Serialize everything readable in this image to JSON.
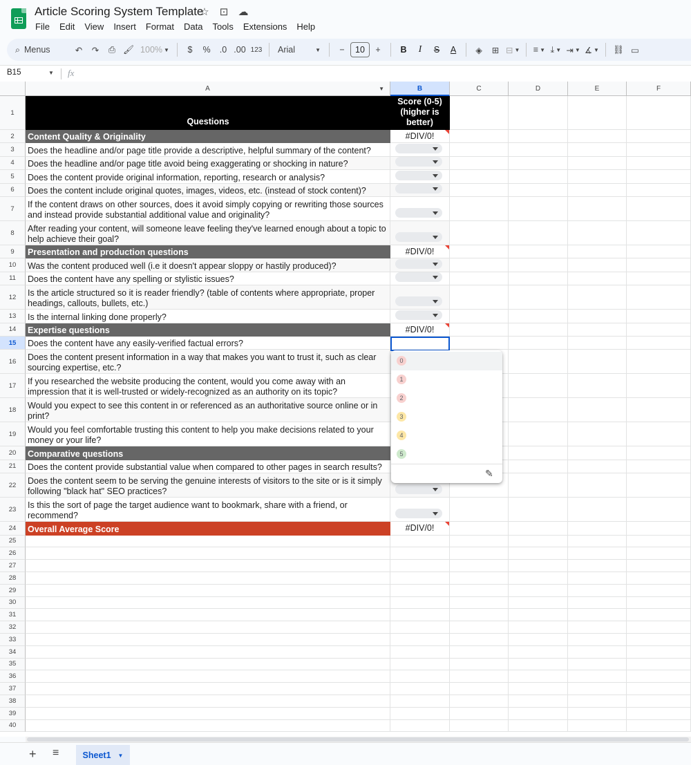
{
  "app": {
    "title": "Article Scoring System Template",
    "title_icons": [
      "star-icon",
      "move-to-folder-icon",
      "cloud-saved-icon"
    ],
    "menu": [
      "File",
      "Edit",
      "View",
      "Insert",
      "Format",
      "Data",
      "Tools",
      "Extensions",
      "Help"
    ]
  },
  "toolbar": {
    "menus_label": "Menus",
    "zoom": "100%",
    "currency": "$",
    "percent": "%",
    "dec_decrease": ".0",
    "dec_increase": ".00",
    "number_format": "123",
    "font": "Arial",
    "font_size": "10",
    "minus": "−",
    "plus": "+",
    "bold": "B",
    "italic": "I",
    "strike": "S",
    "text_color": "A"
  },
  "formula_bar": {
    "name_box": "B15",
    "fx": "fx"
  },
  "columns": [
    "A",
    "B",
    "C",
    "D",
    "E",
    "F"
  ],
  "selected_column": "B",
  "selected_row": 15,
  "rows": [
    {
      "num": 1,
      "type": "header",
      "a": "Questions",
      "b": "Score (0-5) (higher is better)"
    },
    {
      "num": 2,
      "type": "section",
      "a": "Content Quality & Originality",
      "b": "#DIV/0!"
    },
    {
      "num": 3,
      "type": "q",
      "a": "Does the headline and/or page title provide a descriptive, helpful summary of the content?"
    },
    {
      "num": 4,
      "type": "q",
      "a": "Does the headline and/or page title avoid being exaggerating or shocking in nature?"
    },
    {
      "num": 5,
      "type": "q",
      "a": "Does the content provide original information, reporting, research or analysis?"
    },
    {
      "num": 6,
      "type": "q",
      "a": "Does the content include original quotes, images, videos, etc. (instead of stock content)?"
    },
    {
      "num": 7,
      "type": "q",
      "a": "If the content draws on other sources, does it avoid simply copying or rewriting those sources and instead provide substantial additional value and originality?"
    },
    {
      "num": 8,
      "type": "q",
      "a": "After reading your content, will someone leave feeling they've learned enough about a topic to help achieve their goal?"
    },
    {
      "num": 9,
      "type": "section",
      "a": "Presentation and production questions",
      "b": "#DIV/0!"
    },
    {
      "num": 10,
      "type": "q",
      "a": "Was the content produced well (i.e it doesn't appear sloppy or hastily produced)?"
    },
    {
      "num": 11,
      "type": "q",
      "a": "Does the content have any spelling or stylistic issues?"
    },
    {
      "num": 12,
      "type": "q",
      "a": "Is the article structured so it is reader friendly? (table of contents where appropriate, proper headings, callouts, bullets, etc.)"
    },
    {
      "num": 13,
      "type": "q",
      "a": "Is the internal linking done properly?"
    },
    {
      "num": 14,
      "type": "section",
      "a": "Expertise questions",
      "b": "#DIV/0!"
    },
    {
      "num": 15,
      "type": "q",
      "a": "Does the content have any easily-verified factual errors?"
    },
    {
      "num": 16,
      "type": "q",
      "a": "Does the content present information in a way that makes you want to trust it, such as clear sourcing expertise, etc.?"
    },
    {
      "num": 17,
      "type": "q",
      "a": "If you researched the website producing the content, would you come away with an impression that it is well-trusted or widely-recognized as an authority on its topic?"
    },
    {
      "num": 18,
      "type": "q",
      "a": "Would you expect to see this content in or referenced as an authoritative source online or in print?"
    },
    {
      "num": 19,
      "type": "q",
      "a": "Would you feel comfortable trusting this content to help you make decisions related to your money or your life?"
    },
    {
      "num": 20,
      "type": "section",
      "a": "Comparative questions",
      "b": ""
    },
    {
      "num": 21,
      "type": "q",
      "a": "Does the content provide substantial value when compared to other pages in search results?"
    },
    {
      "num": 22,
      "type": "q",
      "a": "Does the content seem to be serving the genuine interests of visitors to the site or is it simply following \"black hat\" SEO practices?"
    },
    {
      "num": 23,
      "type": "q",
      "a": "Is this the sort of page the target audience want to bookmark, share with a friend, or recommend?"
    },
    {
      "num": 24,
      "type": "total",
      "a": "Overall Average Score",
      "b": "#DIV/0!"
    }
  ],
  "empty_rows": [
    25,
    26,
    27,
    28,
    29,
    30,
    31,
    32,
    33,
    34,
    35,
    36,
    37,
    38,
    39,
    40
  ],
  "dropdown": {
    "options": [
      {
        "label": "0",
        "color": "#f8d1cf"
      },
      {
        "label": "1",
        "color": "#f8d1cf"
      },
      {
        "label": "2",
        "color": "#f8d1cf"
      },
      {
        "label": "3",
        "color": "#fde7a6"
      },
      {
        "label": "4",
        "color": "#fde7a6"
      },
      {
        "label": "5",
        "color": "#cfeacd"
      }
    ],
    "edit_icon": "pencil-icon"
  },
  "sheets": {
    "active": "Sheet1"
  }
}
